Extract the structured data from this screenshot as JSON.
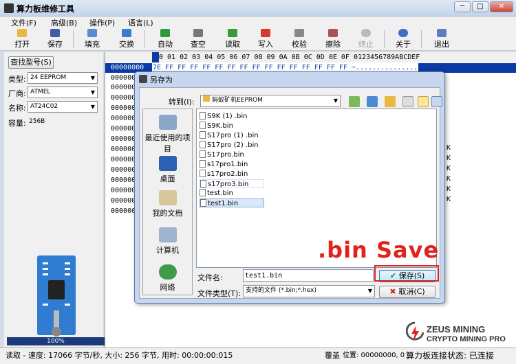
{
  "window": {
    "title": "算力板维修工具",
    "min": "─",
    "max": "□",
    "close": "✕"
  },
  "menu": [
    "文件(F)",
    "高级(B)",
    "操作(P)",
    "语言(L)"
  ],
  "toolbar": [
    "打开",
    "保存",
    "填充",
    "交换",
    "自动",
    "查空",
    "读取",
    "写入",
    "校验",
    "擦除",
    "终止",
    "关于",
    "退出"
  ],
  "left": {
    "find_button": "查找型号(S)",
    "type_label": "类型:",
    "type_value": "24 EEPROM",
    "vendor_label": "厂商:",
    "vendor_value": "ATMEL",
    "name_label": "名称:",
    "name_value": "AT24C02",
    "capacity_label": "容量:",
    "capacity_value": "256B",
    "progress": "100%"
  },
  "hex": {
    "header": "0 01 02 03 04 05 06 07 08 09 0A 0B 0C 0D 0E 0F  0123456789ABCDEF",
    "first_addr": "00000000",
    "first_row": "7E FF FF FF FF FF FF FF FF FF FF FF FF FF FF FF  ~...............",
    "addr_prefix": "000000",
    "k_marks": [
      "K",
      "K",
      "K",
      "K",
      "K",
      "K"
    ]
  },
  "dialog": {
    "title": "另存为",
    "lookin_label": "转到(I):",
    "lookin_value": "蚂蚁矿机EEPROM",
    "places": [
      "最近使用的项目",
      "桌面",
      "我的文档",
      "计算机",
      "网络"
    ],
    "files": [
      "S9K (1) .bin",
      "S9K.bin",
      "S17pro (1) .bin",
      "S17pro (2) .bin",
      "S17pro.bin",
      "s17pro1.bin",
      "s17pro2.bin",
      "s17pro3.bin",
      "test.bin",
      "test1.bin"
    ],
    "filename_label": "文件名:",
    "filename_value": "test1.bin",
    "filetype_label": "文件类型(T):",
    "filetype_value": "支持的文件 (*.bin;*.hex)",
    "save_button": "保存(S)",
    "cancel_button": "取消(C)"
  },
  "annotation": ".bin Save",
  "statusbar": {
    "left": "读取 - 速度: 17066 字节/秒, 大小: 256 字节, 用时: 00:00:00:015",
    "mode": "覆盖",
    "position": "位置: 00000000, 0",
    "connection": "算力板连接状态: 已连接"
  },
  "watermark": {
    "line1": "ZEUS MINING",
    "line2": "CRYPTO MINING PRO"
  },
  "colors": {
    "accent_red": "#e0231c",
    "hex_blue": "#0a3aa5",
    "chip_blue": "#2f7cd1"
  }
}
